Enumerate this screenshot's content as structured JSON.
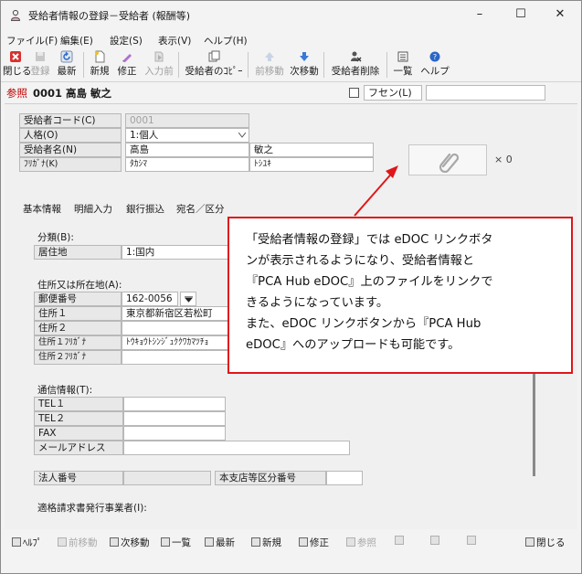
{
  "window": {
    "title": "受給者情報の登録－受給者 (報酬等)",
    "controls": {
      "minimize": "–",
      "maximize": "☐",
      "close": "✕"
    }
  },
  "menu": [
    "ファイル(F)",
    "編集(E)",
    "設定(S)",
    "表示(V)",
    "ヘルプ(H)"
  ],
  "toolbar": [
    {
      "label": "閉じる",
      "icon": "close-red-icon",
      "enabled": true
    },
    {
      "label": "登録",
      "icon": "save-icon",
      "enabled": false
    },
    {
      "label": "最新",
      "icon": "refresh-icon",
      "enabled": true
    },
    {
      "label": "新規",
      "icon": "new-file-icon",
      "enabled": true
    },
    {
      "label": "修正",
      "icon": "edit-icon",
      "enabled": true
    },
    {
      "label": "入力前",
      "icon": "undo-icon",
      "enabled": false
    },
    {
      "label": "受給者のｺﾋﾟｰ",
      "icon": "copy-icon",
      "enabled": true
    },
    {
      "label": "前移動",
      "icon": "up-arrow-icon",
      "enabled": false
    },
    {
      "label": "次移動",
      "icon": "down-arrow-icon",
      "enabled": true
    },
    {
      "label": "受給者削除",
      "icon": "delete-person-icon",
      "enabled": true
    },
    {
      "label": "一覧",
      "icon": "list-icon",
      "enabled": true
    },
    {
      "label": "ヘルプ",
      "icon": "help-icon",
      "enabled": true
    }
  ],
  "reference": {
    "label": "参照",
    "value": "0001 高島 敏之",
    "fusen_label": "フセン(L)",
    "fusen_value": ""
  },
  "header_fields": {
    "code_label": "受給者コード(C)",
    "code_value": "0001",
    "kind_label": "人格(O)",
    "kind_value": "1:個人",
    "name_label": "受給者名(N)",
    "name_last": "高島",
    "name_first": "敏之",
    "kana_label": "ﾌﾘｶﾞﾅ(K)",
    "kana_last": "ﾀｶｼﾏ",
    "kana_first": "ﾄｼﾕｷ"
  },
  "attachment": {
    "icon": "paperclip-icon",
    "count_text": "× 0"
  },
  "tabs": [
    "基本情報",
    "明細入力",
    "銀行振込",
    "宛名／区分"
  ],
  "basic": {
    "category_title": "分類(B):",
    "residence_label": "居住地",
    "residence_value": "1:国内",
    "address_title": "住所又は所在地(A):",
    "postal_label": "郵便番号",
    "postal_value": "162-0056",
    "addr1_label": "住所１",
    "addr1_value": "東京都新宿区若松町",
    "addr2_label": "住所２",
    "addr2_value": "",
    "addr1_kana_label": "住所１ﾌﾘｶﾞﾅ",
    "addr1_kana_value": "ﾄｳｷｮｳﾄｼﾝｼﾞｭｸｸﾜｶﾏﾂﾁｮ",
    "addr2_kana_label": "住所２ﾌﾘｶﾞﾅ",
    "addr2_kana_value": "",
    "contact_title": "通信情報(T):",
    "tel1_label": "TEL１",
    "tel2_label": "TEL２",
    "fax_label": "FAX",
    "mail_label": "メールアドレス",
    "corp_no_label": "法人番号",
    "branch_label": "本支店等区分番号",
    "invoice_title": "適格請求書発行事業者(I):"
  },
  "fkeys": [
    {
      "label": "ﾍﾙﾌﾟ",
      "enabled": true
    },
    {
      "label": "前移動",
      "enabled": false
    },
    {
      "label": "次移動",
      "enabled": true
    },
    {
      "label": "一覧",
      "enabled": true
    },
    {
      "label": "最新",
      "enabled": true
    },
    {
      "label": "新規",
      "enabled": true
    },
    {
      "label": "修正",
      "enabled": true
    },
    {
      "label": "参照",
      "enabled": false
    },
    {
      "label": "",
      "enabled": false
    },
    {
      "label": "",
      "enabled": false
    },
    {
      "label": "",
      "enabled": false
    },
    {
      "label": "閉じる",
      "enabled": true
    }
  ],
  "callout": {
    "lines": [
      "「受給者情報の登録」では eDOC リンクボタ",
      "ンが表示されるようになり、受給者情報と",
      "『PCA Hub eDOC』上のファイルをリンクで",
      "きるようになっています。",
      "また、eDOC リンクボタンから『PCA Hub",
      "eDOC』へのアップロードも可能です。"
    ]
  },
  "colors": {
    "accent_red": "#e0161a",
    "reference_red": "#c00000",
    "panel_bg": "#f0f0f0"
  }
}
